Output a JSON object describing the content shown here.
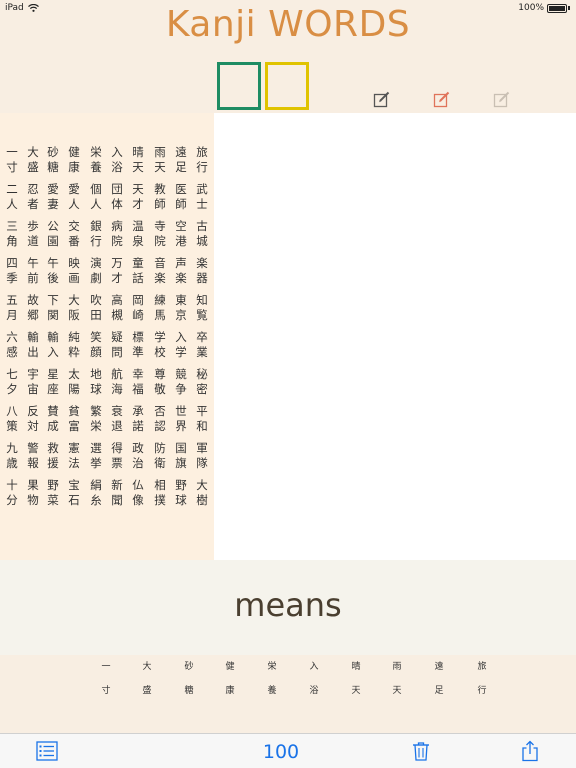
{
  "status": {
    "device": "iPad",
    "battery": "100%"
  },
  "app_title": "Kanji WORDS",
  "word_columns": [
    [
      "旅行",
      "武士",
      "古城",
      "楽器",
      "知覧",
      "卒業",
      "秘密",
      "平和",
      "軍隊",
      "大樹"
    ],
    [
      "遠足",
      "医師",
      "空港",
      "声楽",
      "東京",
      "入学",
      "競争",
      "世界",
      "国旗",
      "野球"
    ],
    [
      "雨天",
      "教師",
      "寺院",
      "音楽",
      "練馬",
      "学校",
      "尊敬",
      "否認",
      "防衛",
      "相撲"
    ],
    [
      "晴天",
      "天才",
      "温泉",
      "童話",
      "岡崎",
      "標準",
      "幸福",
      "承諾",
      "政治",
      "仏像"
    ],
    [
      "入浴",
      "団体",
      "病院",
      "万才",
      "高槻",
      "疑問",
      "航海",
      "衰退",
      "得票",
      "新聞"
    ],
    [
      "栄養",
      "個人",
      "銀行",
      "演劇",
      "吹田",
      "笑顔",
      "地球",
      "繁栄",
      "選挙",
      "絹糸"
    ],
    [
      "健康",
      "愛人",
      "交番",
      "映画",
      "大阪",
      "純粋",
      "太陽",
      "貧富",
      "憲法",
      "宝石"
    ],
    [
      "砂糖",
      "愛妻",
      "公園",
      "午後",
      "下関",
      "輸入",
      "星座",
      "賛成",
      "救援",
      "野菜"
    ],
    [
      "大盛",
      "忍者",
      "歩道",
      "午前",
      "故郷",
      "輸出",
      "宇宙",
      "反対",
      "警報",
      "果物"
    ],
    [
      "一寸",
      "二人",
      "三角",
      "四季",
      "五月",
      "六感",
      "七夕",
      "八策",
      "九歳",
      "十分"
    ]
  ],
  "means_label": "means",
  "strip_columns": [
    [
      "一",
      "寸"
    ],
    [
      "大",
      "盛"
    ],
    [
      "砂",
      "糖"
    ],
    [
      "健",
      "康"
    ],
    [
      "栄",
      "養"
    ],
    [
      "入",
      "浴"
    ],
    [
      "晴",
      "天"
    ],
    [
      "雨",
      "天"
    ],
    [
      "遠",
      "足"
    ],
    [
      "旅",
      "行"
    ]
  ],
  "count": "100",
  "colors": {
    "title": "#d98e44",
    "box_green": "#1e8c63",
    "box_yellow": "#e0c300",
    "toolbar_blue": "#1a73e8"
  },
  "icons": {
    "edit_1": "edit-dark-icon",
    "edit_2": "edit-red-icon",
    "edit_3": "edit-light-icon",
    "list": "list-icon",
    "trash": "trash-icon",
    "share": "share-icon"
  }
}
